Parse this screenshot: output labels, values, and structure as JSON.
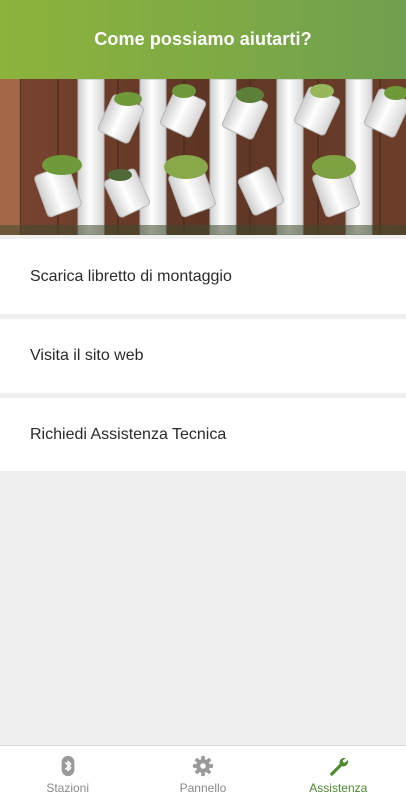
{
  "header": {
    "title": "Come possiamo aiutarti?"
  },
  "banner": {
    "image": "vertical-pvc-pipe-planter-photo"
  },
  "menu": {
    "items": [
      {
        "label": "Scarica libretto di montaggio"
      },
      {
        "label": "Visita il sito web"
      },
      {
        "label": "Richiedi Assistenza Tecnica"
      }
    ]
  },
  "tabbar": {
    "tabs": [
      {
        "label": "Stazioni",
        "icon": "bluetooth-icon",
        "active": false
      },
      {
        "label": "Pannello",
        "icon": "gear-icon",
        "active": false
      },
      {
        "label": "Assistenza",
        "icon": "wrench-icon",
        "active": true
      }
    ]
  },
  "colors": {
    "header_start": "#8cb33b",
    "header_end": "#6f9f50",
    "active_tab": "#4d8a2c",
    "inactive_tab": "#8a8a8a",
    "background": "#f0f0f0"
  }
}
